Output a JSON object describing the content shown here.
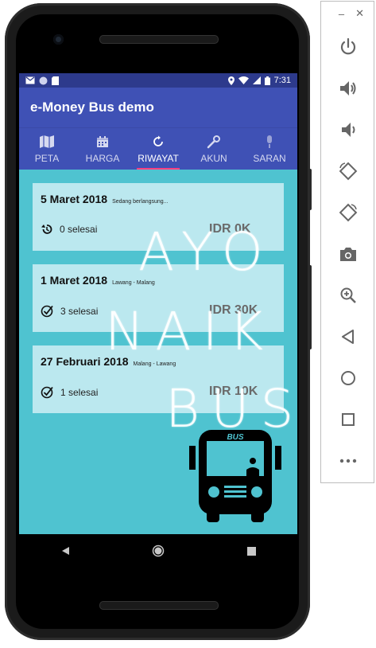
{
  "status_bar": {
    "time": "7:31"
  },
  "app_bar": {
    "title": "e-Money Bus demo"
  },
  "tabs": [
    {
      "label": "PETA",
      "icon": "map-icon"
    },
    {
      "label": "HARGA",
      "icon": "calendar-icon"
    },
    {
      "label": "RIWAYAT",
      "icon": "history-icon",
      "active": true
    },
    {
      "label": "AKUN",
      "icon": "wrench-icon"
    },
    {
      "label": "SARAN",
      "icon": "microphone-icon"
    }
  ],
  "trips": [
    {
      "date": "5 Maret 2018",
      "route": "Sedang berlangsung...",
      "status_icon": "history-icon",
      "status": "0 selesai",
      "amount": "IDR 0K"
    },
    {
      "date": "1 Maret 2018",
      "route": "Lawang - Malang",
      "status_icon": "check-circle-icon",
      "status": "3 selesai",
      "amount": "IDR 30K"
    },
    {
      "date": "27 Februari 2018",
      "route": "Malang - Lawang",
      "status_icon": "check-circle-icon",
      "status": "1 selesai",
      "amount": "IDR 10K"
    }
  ],
  "background_art": {
    "line1": "AYO",
    "line2": "NAIK",
    "line3": "BUS",
    "bus_label": "BUS"
  },
  "colors": {
    "primary": "#3f51b5",
    "status_bar": "#2d3a8c",
    "accent": "#ff4081",
    "background": "#4fc3d0"
  },
  "emulator_controls": [
    "minimize-icon",
    "close-icon",
    "power-icon",
    "volume-up-icon",
    "volume-down-icon",
    "rotate-left-icon",
    "rotate-right-icon",
    "camera-icon",
    "zoom-icon",
    "back-icon",
    "home-icon",
    "overview-icon",
    "more-icon"
  ]
}
